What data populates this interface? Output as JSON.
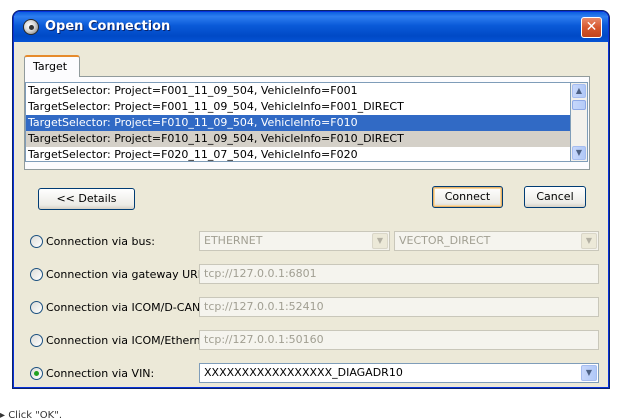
{
  "window": {
    "title": "Open Connection",
    "close_glyph": "✕"
  },
  "tabs": [
    {
      "label": "Target"
    }
  ],
  "target_list": {
    "items": [
      "TargetSelector: Project=F001_11_09_504, VehicleInfo=F001",
      "TargetSelector: Project=F001_11_09_504, VehicleInfo=F001_DIRECT",
      "TargetSelector: Project=F010_11_09_504, VehicleInfo=F010",
      "TargetSelector: Project=F010_11_09_504, VehicleInfo=F010_DIRECT",
      "TargetSelector: Project=F020_11_07_504, VehicleInfo=F020"
    ],
    "selected_index": 2
  },
  "buttons": {
    "details": "<< Details",
    "connect": "Connect",
    "cancel": "Cancel"
  },
  "options": {
    "bus": {
      "label": "Connection via bus:",
      "value1": "ETHERNET",
      "value2": "VECTOR_DIRECT",
      "checked": false
    },
    "gateway": {
      "label": "Connection via gateway URL:",
      "value": "tcp://127.0.0.1:6801",
      "checked": false
    },
    "icom_dcan": {
      "label": "Connection via ICOM/D-CAN:",
      "value": "tcp://127.0.0.1:52410",
      "checked": false
    },
    "icom_eth": {
      "label": "Connection via ICOM/Ethernet:",
      "value": "tcp://127.0.0.1:50160",
      "checked": false
    },
    "vin": {
      "label": "Connection via VIN:",
      "value": "XXXXXXXXXXXXXXXXX_DIAGADR10",
      "checked": true
    }
  },
  "footer_text": "▸ Click \"OK\".",
  "icons": {
    "app": "connection-icon",
    "close": "close-icon",
    "scroll_up": "scroll-up-icon",
    "scroll_down": "scroll-down-icon",
    "dropdown": "chevron-down-icon"
  },
  "colors": {
    "titlebar": "#0a5ad8",
    "selection": "#316ac5",
    "window_bg": "#ece9d8",
    "close_btn": "#d6582e",
    "radio_dot": "#21a121"
  }
}
